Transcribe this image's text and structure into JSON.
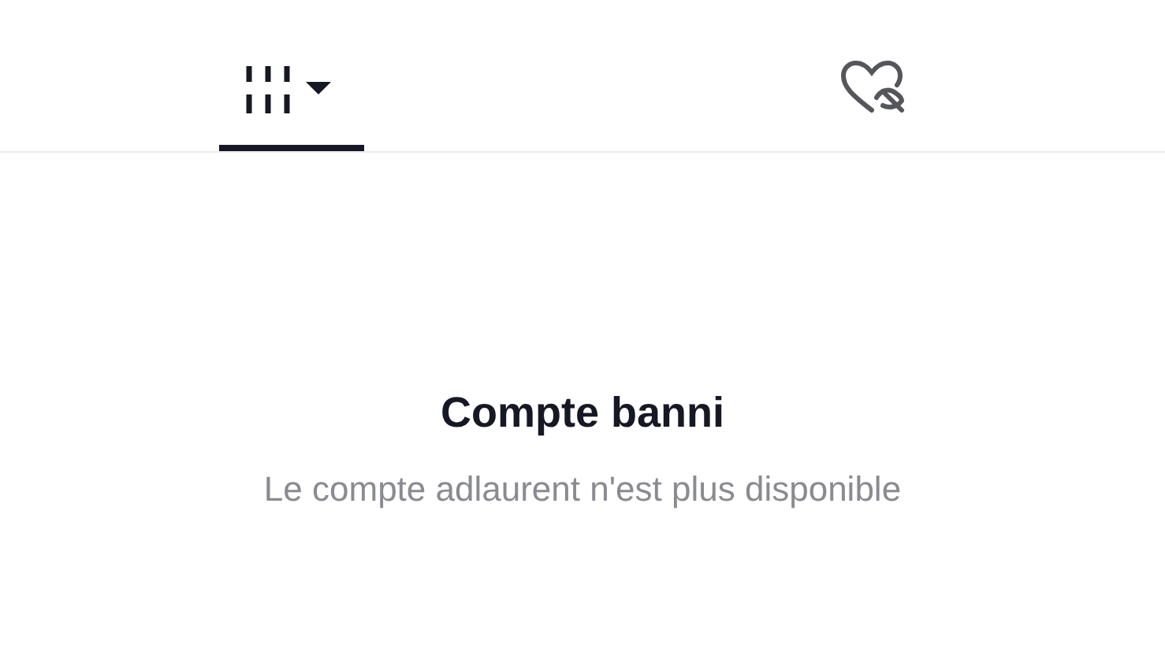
{
  "tabs": [
    {
      "kind": "videos",
      "selected": true
    },
    {
      "kind": "liked",
      "selected": false
    }
  ],
  "message": {
    "title": "Compte banni",
    "subtitle": "Le compte adlaurent n'est plus disponible"
  }
}
